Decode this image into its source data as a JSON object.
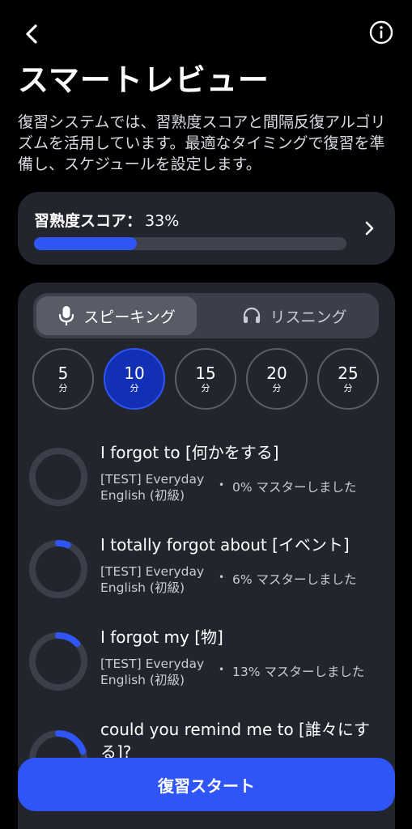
{
  "header": {
    "back_icon": "chevron-left-icon",
    "info_icon": "info-circle-icon"
  },
  "title": "スマートレビュー",
  "description": "復習システムでは、習熟度スコアと間隔反復アルゴリズムを活用しています。最適なタイミングで復習を準備し、スケジュールを設定します。",
  "score": {
    "label": "習熟度スコア：",
    "value_text": "33%",
    "value_fraction": 0.33,
    "chevron_icon": "chevron-right-icon"
  },
  "mode_tabs": [
    {
      "label": "スピーキング",
      "icon": "microphone-icon",
      "active": true
    },
    {
      "label": "リスニング",
      "icon": "headphones-icon",
      "active": false
    }
  ],
  "durations": [
    {
      "value": "5",
      "unit": "分",
      "selected": false
    },
    {
      "value": "10",
      "unit": "分",
      "selected": true
    },
    {
      "value": "15",
      "unit": "分",
      "selected": false
    },
    {
      "value": "20",
      "unit": "分",
      "selected": false
    },
    {
      "value": "25",
      "unit": "分",
      "selected": false
    }
  ],
  "items": [
    {
      "title": "I forgot to [何かをする]",
      "course": "[TEST] Everyday English (初級)",
      "mastery_text": "0% マスターしました",
      "mastery": 0.0
    },
    {
      "title": "I totally forgot about [イベント]",
      "course": "[TEST] Everyday English (初級)",
      "mastery_text": "6% マスターしました",
      "mastery": 0.06
    },
    {
      "title": "I forgot my [物]",
      "course": "[TEST] Everyday English (初級)",
      "mastery_text": "13% マスターしました",
      "mastery": 0.13
    },
    {
      "title": "could you remind me to [誰々にする]?",
      "course": "",
      "mastery_text": "",
      "mastery": 0.2
    }
  ],
  "start_button": "復習スタート",
  "colors": {
    "accent": "#2f55f6",
    "selected_duration_bg": "#1230b6",
    "card_bg": "#22252d",
    "ring_track": "#3a3f4a"
  }
}
